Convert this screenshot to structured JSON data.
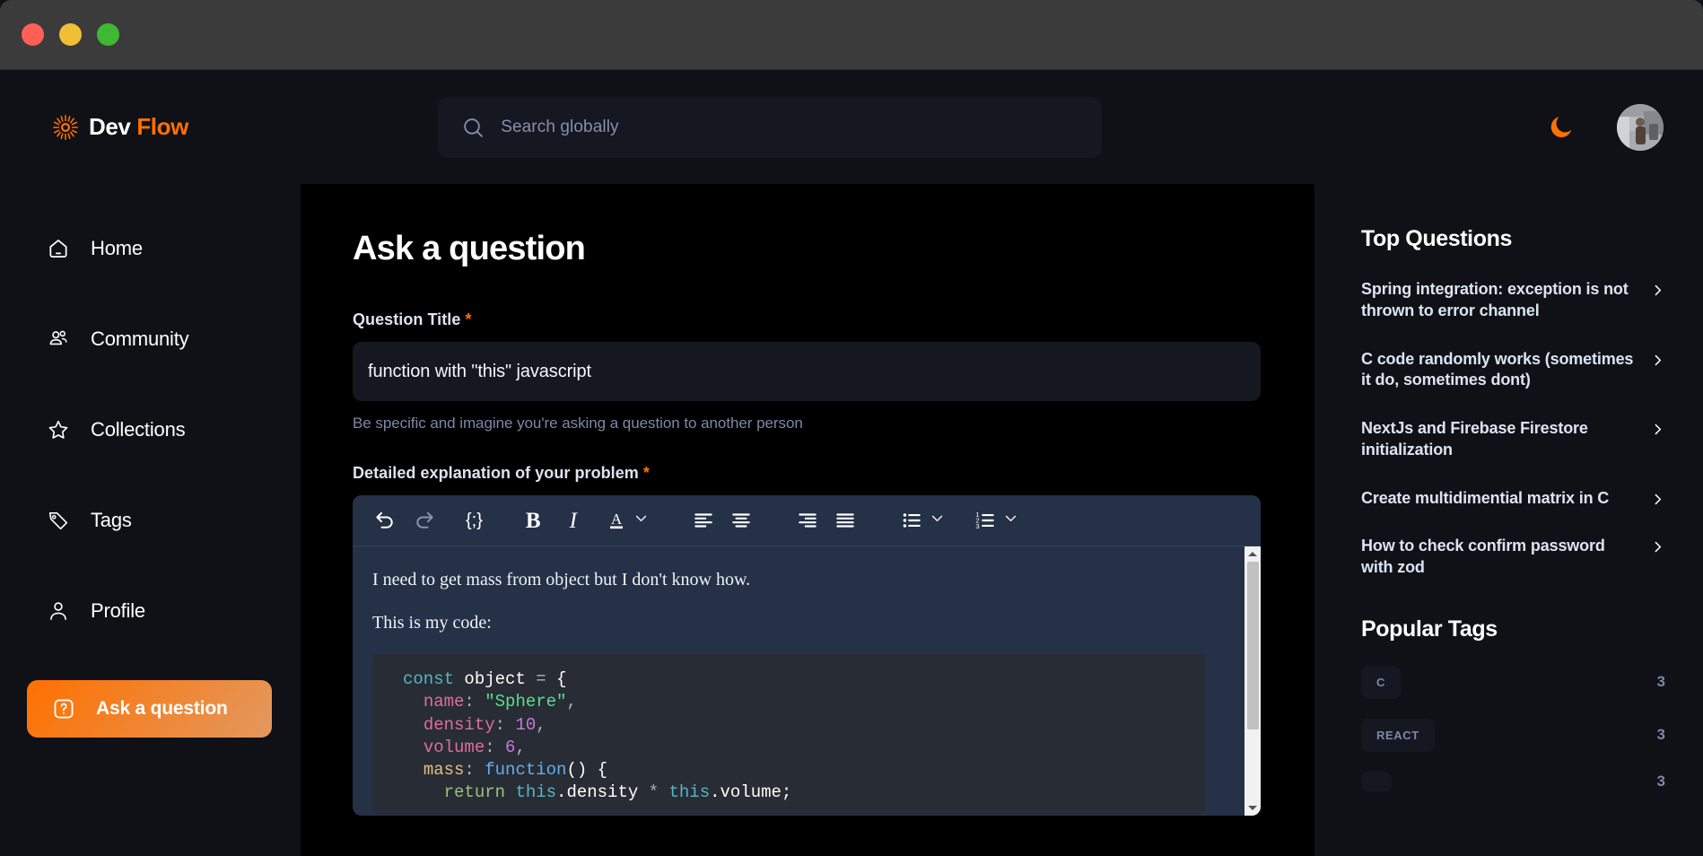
{
  "window": {
    "traffic_lights": [
      "close",
      "minimize",
      "maximize"
    ],
    "colors": {
      "close": "#ff5f57",
      "minimize": "#f0bf33",
      "maximize": "#3fb832"
    }
  },
  "brand": {
    "name_primary": "Dev",
    "name_accent": "Flow",
    "accent_color": "#FF7000",
    "logo_icon": "sun-burst-icon"
  },
  "search": {
    "placeholder": "Search globally",
    "value": "",
    "icon": "search-icon"
  },
  "header": {
    "theme_toggle_icon": "moon-icon",
    "theme_toggle_color": "#FF7000",
    "avatar_icon": "user-avatar"
  },
  "sidebar": {
    "items": [
      {
        "label": "Home",
        "icon": "home-icon",
        "active": false
      },
      {
        "label": "Community",
        "icon": "users-icon",
        "active": false
      },
      {
        "label": "Collections",
        "icon": "star-icon",
        "active": false
      },
      {
        "label": "Tags",
        "icon": "tag-icon",
        "active": false
      },
      {
        "label": "Profile",
        "icon": "person-icon",
        "active": false
      }
    ],
    "cta": {
      "label": "Ask a question",
      "icon": "question-square-icon"
    }
  },
  "main": {
    "page_title": "Ask a question",
    "title_field": {
      "label": "Question Title",
      "required_marker": "*",
      "value": "function with \"this\" javascript",
      "hint": "Be specific and imagine you're asking a question to another person"
    },
    "explanation_field": {
      "label": "Detailed explanation of your problem",
      "required_marker": "*"
    },
    "toolbar": [
      {
        "name": "undo-icon",
        "label": "undo"
      },
      {
        "name": "redo-icon",
        "label": "redo"
      },
      {
        "name": "code-block-icon",
        "label": "{;}"
      },
      {
        "name": "bold-icon",
        "label": "B"
      },
      {
        "name": "italic-icon",
        "label": "I"
      },
      {
        "name": "text-color-icon",
        "label": "A"
      },
      {
        "name": "align-left-icon",
        "label": "align left"
      },
      {
        "name": "align-center-icon",
        "label": "align center"
      },
      {
        "name": "align-right-icon",
        "label": "align right"
      },
      {
        "name": "align-justify-icon",
        "label": "justify"
      },
      {
        "name": "bullet-list-icon",
        "label": "bullet list"
      },
      {
        "name": "ordered-list-icon",
        "label": "ordered list"
      }
    ],
    "editor_content": {
      "paragraphs": [
        "I need to get mass from object but I don't know how.",
        "This is my code:"
      ],
      "code_lines": [
        "const object = {",
        "  name: \"Sphere\",",
        "  density: 10,",
        "  volume: 6,",
        "  mass: function() {",
        "    return this.density * this.volume;"
      ]
    },
    "scrollbar": {
      "up_arrow": "triangle-up",
      "down_arrow": "triangle-down"
    }
  },
  "right_sidebar": {
    "top_questions_title": "Top Questions",
    "questions": [
      "Spring integration: exception is not thrown to error channel",
      "C code randomly works (sometimes it do, sometimes dont)",
      "NextJs and Firebase Firestore initialization",
      "Create multidimential matrix in C",
      "How to check confirm password with zod"
    ],
    "chevron_icon": "chevron-right-icon",
    "popular_tags_title": "Popular Tags",
    "tags": [
      {
        "label": "C",
        "count": "3"
      },
      {
        "label": "REACT",
        "count": "3"
      },
      {
        "label": "",
        "count": "3"
      }
    ]
  }
}
